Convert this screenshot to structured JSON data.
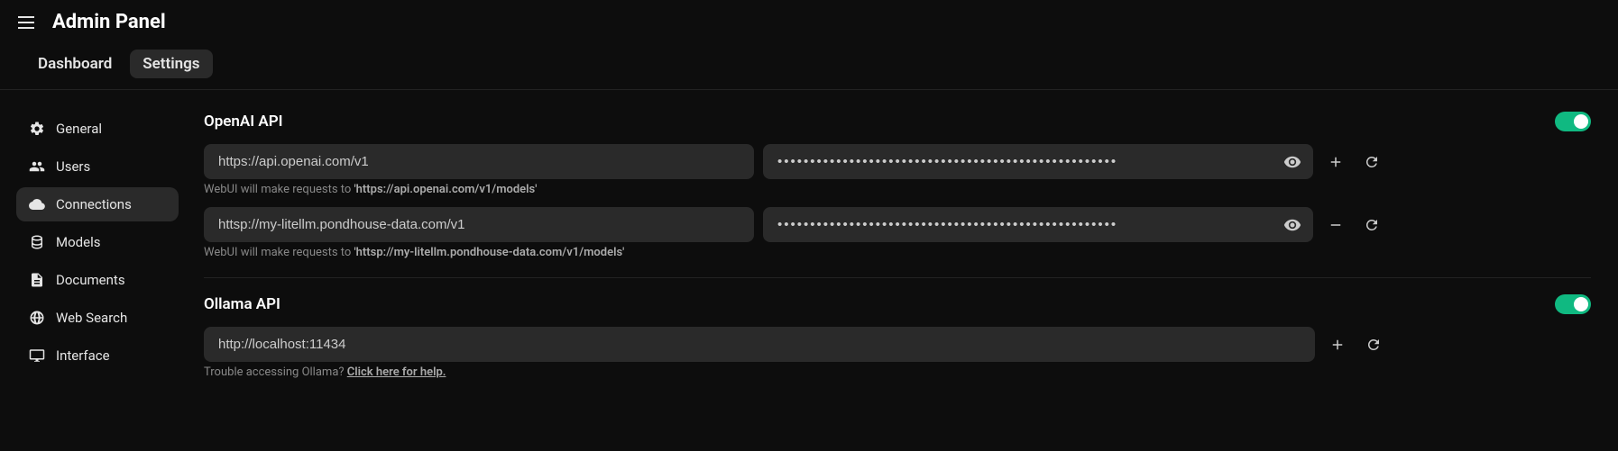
{
  "header": {
    "title": "Admin Panel"
  },
  "tabs": [
    {
      "label": "Dashboard",
      "active": false
    },
    {
      "label": "Settings",
      "active": true
    }
  ],
  "sidebar": {
    "items": [
      {
        "label": "General",
        "icon": "gear"
      },
      {
        "label": "Users",
        "icon": "users"
      },
      {
        "label": "Connections",
        "icon": "cloud",
        "active": true
      },
      {
        "label": "Models",
        "icon": "database"
      },
      {
        "label": "Documents",
        "icon": "document"
      },
      {
        "label": "Web Search",
        "icon": "globe"
      },
      {
        "label": "Interface",
        "icon": "monitor"
      }
    ]
  },
  "openai": {
    "title": "OpenAI API",
    "enabled": true,
    "endpoints": [
      {
        "url": "https://api.openai.com/v1",
        "key_mask": "••••••••••••••••••••••••••••••••••••••••••••••••••••",
        "hint_prefix": "WebUI will make requests to ",
        "hint_url": "'https://api.openai.com/v1/models'",
        "action": "plus"
      },
      {
        "url": "httsp://my-litellm.pondhouse-data.com/v1",
        "key_mask": "••••••••••••••••••••••••••••••••••••••••••••••••••••",
        "hint_prefix": "WebUI will make requests to ",
        "hint_url": "'httsp://my-litellm.pondhouse-data.com/v1/models'",
        "action": "minus"
      }
    ]
  },
  "ollama": {
    "title": "Ollama API",
    "enabled": true,
    "url": "http://localhost:11434",
    "hint_prefix": "Trouble accessing Ollama? ",
    "hint_link": "Click here for help."
  }
}
